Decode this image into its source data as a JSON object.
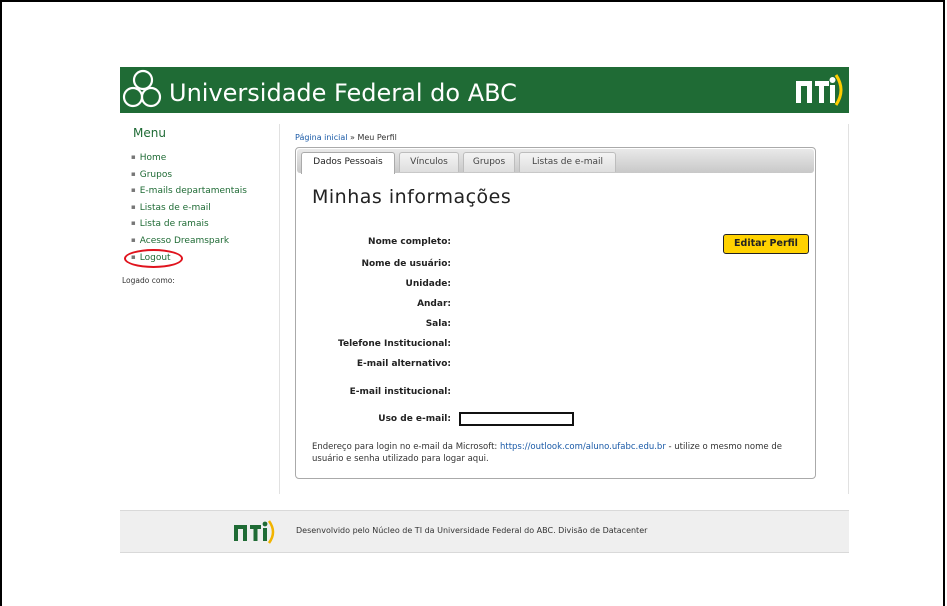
{
  "header": {
    "site_title": "Universidade Federal do ABC",
    "brand_color": "#1f6b35",
    "right_logo": "nti-logo"
  },
  "sidebar": {
    "menu_title": "Menu",
    "items": [
      {
        "label": "Home"
      },
      {
        "label": "Grupos"
      },
      {
        "label": "E-mails departamentais"
      },
      {
        "label": "Listas de e-mail"
      },
      {
        "label": "Lista de ramais"
      },
      {
        "label": "Acesso Dreamspark"
      },
      {
        "label": "Logout"
      }
    ],
    "logged_as": "Logado como:",
    "highlight_color": "#e0131d"
  },
  "breadcrumb": {
    "home_link": "Página inicial",
    "separator": " » ",
    "current": "Meu Perfil"
  },
  "tabs": [
    {
      "label": "Dados Pessoais",
      "active": true
    },
    {
      "label": "Vínculos",
      "active": false
    },
    {
      "label": "Grupos",
      "active": false
    },
    {
      "label": "Listas de e-mail",
      "active": false
    }
  ],
  "profile": {
    "title": "Minhas informações",
    "edit_button": "Editar Perfil",
    "edit_button_color": "#ffd200",
    "fields": [
      {
        "label": "Nome completo:",
        "value": ""
      },
      {
        "label": "Nome de usuário:",
        "value": ""
      },
      {
        "label": "Unidade:",
        "value": ""
      },
      {
        "label": "Andar:",
        "value": ""
      },
      {
        "label": "Sala:",
        "value": ""
      },
      {
        "label": "Telefone Institucional:",
        "value": ""
      },
      {
        "label": "E-mail alternativo:",
        "value": ""
      },
      {
        "label": "E-mail institucional:",
        "value": ""
      },
      {
        "label": "Uso de e-mail:",
        "value": ""
      }
    ],
    "note_prefix": "Endereço para login no e-mail da Microsoft: ",
    "note_link": "https://outlook.com/aluno.ufabc.edu.br",
    "note_suffix": " - utilize o mesmo nome de usuário e senha utilizado para logar aqui."
  },
  "footer": {
    "text": "Desenvolvido pelo Núcleo de TI da Universidade Federal do ABC. Divisão de Datacenter",
    "logo": "nti-logo"
  }
}
